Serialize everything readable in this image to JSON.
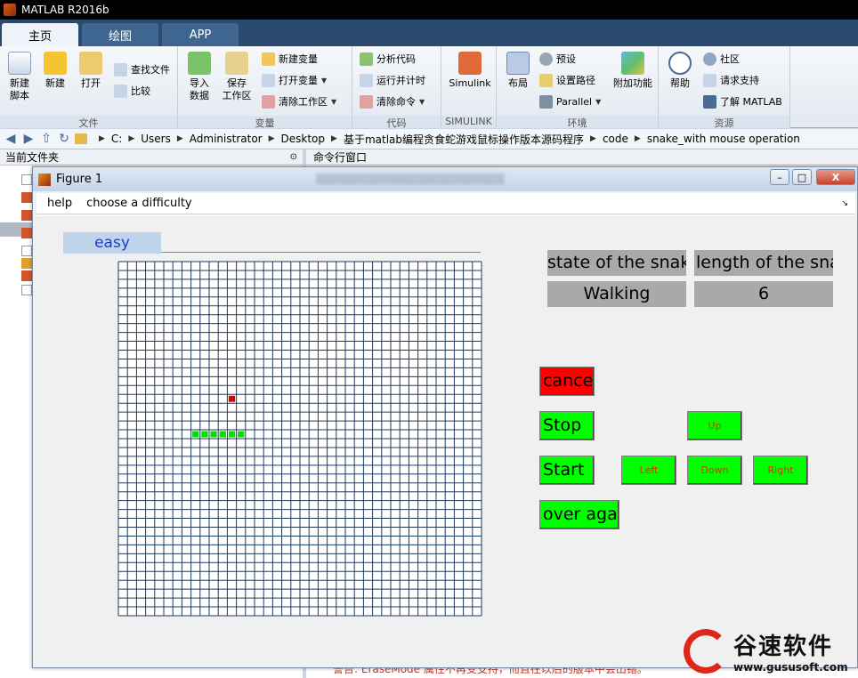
{
  "app": {
    "title": "MATLAB R2016b"
  },
  "ribbon_tabs": [
    "主页",
    "绘图",
    "APP"
  ],
  "ribbon": {
    "file_group": {
      "title": "文件",
      "new_script": "新建\n脚本",
      "new": "新建",
      "open": "打开",
      "find_files": "查找文件",
      "compare": "比较"
    },
    "variable_group": {
      "title": "变量",
      "import": "导入\n数据",
      "save_ws": "保存\n工作区",
      "new_var": "新建变量",
      "open_var": "打开变量",
      "clear_ws": "清除工作区"
    },
    "code_group": {
      "title": "代码",
      "analyze": "分析代码",
      "run_time": "运行并计时",
      "clear_cmd": "清除命令"
    },
    "simulink_group": {
      "title": "SIMULINK",
      "simulink": "Simulink"
    },
    "env_group": {
      "title": "环境",
      "layout": "布局",
      "prefs": "预设",
      "set_path": "设置路径",
      "parallel": "Parallel",
      "addons": "附加功能"
    },
    "resources_group": {
      "title": "资源",
      "help": "帮助",
      "community": "社区",
      "support": "请求支持",
      "learn": "了解 MATLAB"
    }
  },
  "address": {
    "segments": [
      "C:",
      "Users",
      "Administrator",
      "Desktop",
      "基于matlab编程贪食蛇游戏鼠标操作版本源码程序",
      "code",
      "snake_with mouse operation"
    ]
  },
  "panels": {
    "current_folder": "当前文件夹",
    "command_window": "命令行窗口",
    "warning_text": "警告: EraseMode 属性不再受支持，而且在以后的版本中会出错。"
  },
  "figure": {
    "title": "Figure 1",
    "menu": [
      "help",
      "choose a difficulty"
    ],
    "difficulty": "easy",
    "grid": {
      "cols": 40,
      "rows": 40
    },
    "snake_cells": [
      [
        8,
        19
      ],
      [
        9,
        19
      ],
      [
        10,
        19
      ],
      [
        11,
        19
      ],
      [
        12,
        19
      ],
      [
        13,
        19
      ]
    ],
    "food_cell": [
      12,
      15
    ],
    "colors": {
      "snake": "#00e000",
      "food": "#e00000",
      "grid_line": "#203a5a"
    },
    "info": {
      "state_label": "state of the snake",
      "length_label": "length of the snake",
      "state_value": "Walking",
      "length_value": "6"
    },
    "buttons": {
      "cancel": "cancel",
      "stop": "Stop",
      "start": "Start",
      "over_again": "over again",
      "up": "Up",
      "left": "Left",
      "down": "Down",
      "right": "Right"
    }
  },
  "watermark": {
    "name": "谷速软件",
    "url": "www.gususoft.com"
  }
}
